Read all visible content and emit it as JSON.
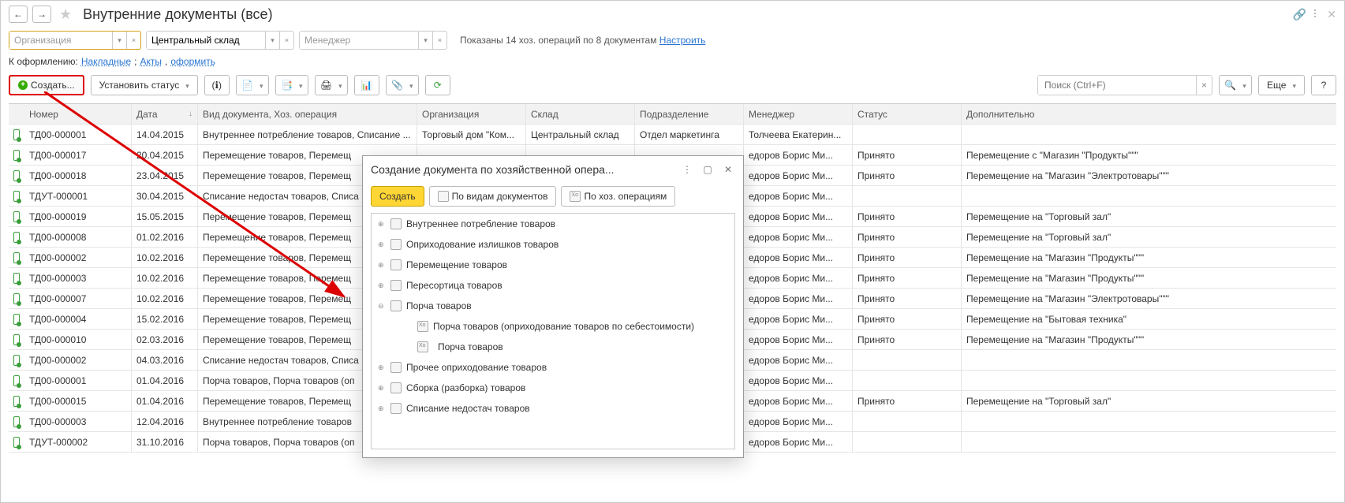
{
  "header": {
    "title": "Внутренние документы (все)"
  },
  "filters": {
    "org_placeholder": "Организация",
    "sklad_value": "Центральный склад",
    "mgr_placeholder": "Менеджер",
    "summary": "Показаны 14 хоз. операций по 8 документам",
    "configure": "Настроить"
  },
  "drafts": {
    "label": "К оформлению:",
    "link1": "Накладные",
    "link2": "Акты",
    "link3": "оформить"
  },
  "toolbar": {
    "create": "Создать...",
    "set_status": "Установить статус",
    "search_placeholder": "Поиск (Ctrl+F)",
    "more": "Еще"
  },
  "columns": {
    "num": "Номер",
    "date": "Дата",
    "doc": "Вид документа, Хоз. операция",
    "org": "Организация",
    "sklad": "Склад",
    "dep": "Подразделение",
    "mgr": "Менеджер",
    "status": "Статус",
    "extra": "Дополнительно"
  },
  "rows": [
    {
      "num": "ТД00-000001",
      "date": "14.04.2015",
      "doc": "Внутреннее потребление товаров, Списание ...",
      "org": "Торговый дом \"Ком...",
      "sklad": "Центральный склад",
      "dep": "Отдел маркетинга",
      "mgr": "Толчеева Екатерин...",
      "status": "",
      "extra": ""
    },
    {
      "num": "ТД00-000017",
      "date": "20.04.2015",
      "doc": "Перемещение товаров, Перемещ",
      "org": "",
      "sklad": "",
      "dep": "",
      "mgr": "едоров Борис Ми...",
      "status": "Принято",
      "extra": "Перемещение с \"Магазин \"Продукты\"\"\""
    },
    {
      "num": "ТД00-000018",
      "date": "23.04.2015",
      "doc": "Перемещение товаров, Перемещ",
      "org": "",
      "sklad": "",
      "dep": "",
      "mgr": "едоров Борис Ми...",
      "status": "Принято",
      "extra": "Перемещение на \"Магазин \"Электротовары\"\"\""
    },
    {
      "num": "ТДУТ-000001",
      "date": "30.04.2015",
      "doc": "Списание недостач товаров, Списа",
      "org": "",
      "sklad": "",
      "dep": "",
      "mgr": "едоров Борис Ми...",
      "status": "",
      "extra": ""
    },
    {
      "num": "ТД00-000019",
      "date": "15.05.2015",
      "doc": "Перемещение товаров, Перемещ",
      "org": "",
      "sklad": "",
      "dep": "",
      "mgr": "едоров Борис Ми...",
      "status": "Принято",
      "extra": "Перемещение на \"Торговый зал\""
    },
    {
      "num": "ТД00-000008",
      "date": "01.02.2016",
      "doc": "Перемещение товаров, Перемещ",
      "org": "",
      "sklad": "",
      "dep": "",
      "mgr": "едоров Борис Ми...",
      "status": "Принято",
      "extra": "Перемещение на \"Торговый зал\""
    },
    {
      "num": "ТД00-000002",
      "date": "10.02.2016",
      "doc": "Перемещение товаров, Перемещ",
      "org": "",
      "sklad": "",
      "dep": "",
      "mgr": "едоров Борис Ми...",
      "status": "Принято",
      "extra": "Перемещение на \"Магазин \"Продукты\"\"\""
    },
    {
      "num": "ТД00-000003",
      "date": "10.02.2016",
      "doc": "Перемещение товаров, Перемещ",
      "org": "",
      "sklad": "",
      "dep": "",
      "mgr": "едоров Борис Ми...",
      "status": "Принято",
      "extra": "Перемещение на \"Магазин \"Продукты\"\"\""
    },
    {
      "num": "ТД00-000007",
      "date": "10.02.2016",
      "doc": "Перемещение товаров, Перемещ",
      "org": "",
      "sklad": "",
      "dep": "",
      "mgr": "едоров Борис Ми...",
      "status": "Принято",
      "extra": "Перемещение на \"Магазин \"Электротовары\"\"\""
    },
    {
      "num": "ТД00-000004",
      "date": "15.02.2016",
      "doc": "Перемещение товаров, Перемещ",
      "org": "",
      "sklad": "",
      "dep": "",
      "mgr": "едоров Борис Ми...",
      "status": "Принято",
      "extra": "Перемещение на \"Бытовая техника\""
    },
    {
      "num": "ТД00-000010",
      "date": "02.03.2016",
      "doc": "Перемещение товаров, Перемещ",
      "org": "",
      "sklad": "",
      "dep": "",
      "mgr": "едоров Борис Ми...",
      "status": "Принято",
      "extra": "Перемещение на \"Магазин \"Продукты\"\"\""
    },
    {
      "num": "ТД00-000002",
      "date": "04.03.2016",
      "doc": "Списание недостач товаров, Списа",
      "org": "",
      "sklad": "",
      "dep": "",
      "mgr": "едоров Борис Ми...",
      "status": "",
      "extra": ""
    },
    {
      "num": "ТД00-000001",
      "date": "01.04.2016",
      "doc": "Порча товаров, Порча товаров (оп",
      "org": "",
      "sklad": "",
      "dep": "",
      "mgr": "едоров Борис Ми...",
      "status": "",
      "extra": ""
    },
    {
      "num": "ТД00-000015",
      "date": "01.04.2016",
      "doc": "Перемещение товаров, Перемещ",
      "org": "",
      "sklad": "",
      "dep": "",
      "mgr": "едоров Борис Ми...",
      "status": "Принято",
      "extra": "Перемещение на \"Торговый зал\""
    },
    {
      "num": "ТД00-000003",
      "date": "12.04.2016",
      "doc": "Внутреннее потребление товаров",
      "org": "",
      "sklad": "",
      "dep": "",
      "mgr": "едоров Борис Ми...",
      "status": "",
      "extra": ""
    },
    {
      "num": "ТДУТ-000002",
      "date": "31.10.2016",
      "doc": "Порча товаров, Порча товаров (оп",
      "org": "",
      "sklad": "",
      "dep": "",
      "mgr": "едоров Борис Ми...",
      "status": "",
      "extra": ""
    }
  ],
  "dialog": {
    "title": "Создание документа по хозяйственной опера...",
    "create": "Создать",
    "by_doc": "По видам документов",
    "by_op": "По хоз. операциям",
    "items": [
      {
        "label": "Внутреннее потребление товаров",
        "kind": "group"
      },
      {
        "label": "Оприходование излишков товаров",
        "kind": "group"
      },
      {
        "label": "Перемещение товаров",
        "kind": "group"
      },
      {
        "label": "Пересортица товаров",
        "kind": "group"
      },
      {
        "label": "Порча товаров",
        "kind": "group",
        "expanded": true
      },
      {
        "label": "Порча товаров (оприходование товаров по себестоимости)",
        "kind": "leaf"
      },
      {
        "label": "Порча товаров",
        "kind": "leaf",
        "selected": true
      },
      {
        "label": "Прочее оприходование товаров",
        "kind": "group"
      },
      {
        "label": "Сборка (разборка) товаров",
        "kind": "group"
      },
      {
        "label": "Списание недостач товаров",
        "kind": "group"
      }
    ]
  }
}
